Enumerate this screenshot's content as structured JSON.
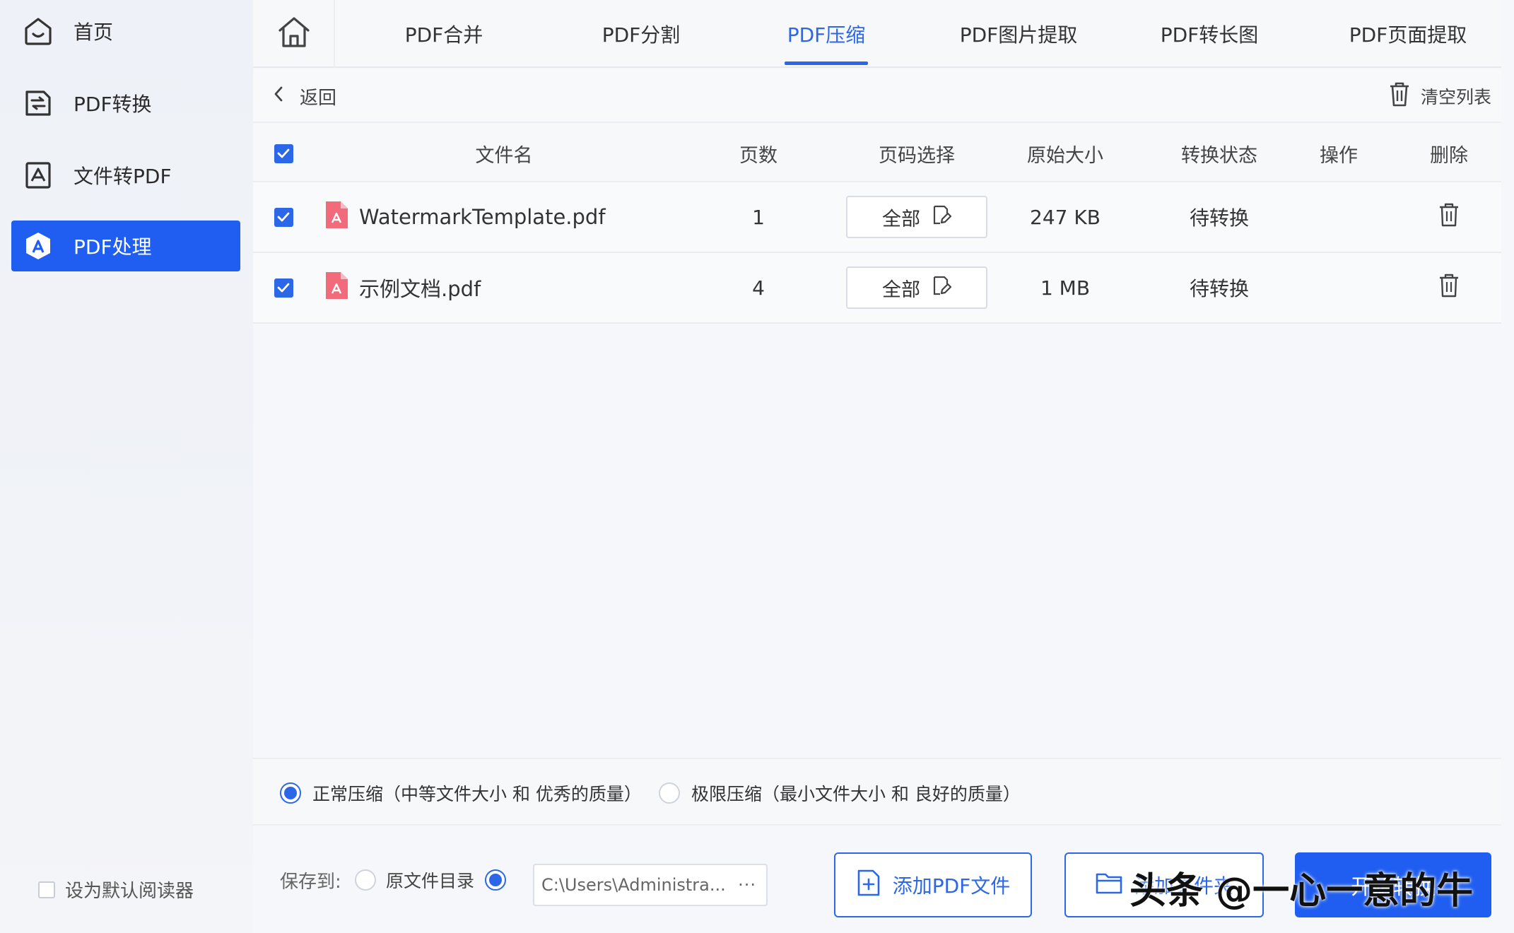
{
  "sidebar": {
    "items": [
      {
        "label": "首页",
        "icon": "home-icon"
      },
      {
        "label": "PDF转换",
        "icon": "convert-icon"
      },
      {
        "label": "文件转PDF",
        "icon": "file-to-pdf-icon"
      },
      {
        "label": "PDF处理",
        "icon": "pdf-process-icon",
        "active": true
      }
    ],
    "default_reader_label": "设为默认阅读器"
  },
  "tabs": [
    {
      "label": "PDF合并"
    },
    {
      "label": "PDF分割"
    },
    {
      "label": "PDF压缩",
      "active": true
    },
    {
      "label": "PDF图片提取"
    },
    {
      "label": "PDF转长图"
    },
    {
      "label": "PDF页面提取"
    }
  ],
  "backbar": {
    "back_label": "返回",
    "clear_label": "清空列表"
  },
  "table": {
    "headers": {
      "filename": "文件名",
      "pages": "页数",
      "page_select": "页码选择",
      "size": "原始大小",
      "status": "转换状态",
      "action": "操作",
      "delete": "删除"
    },
    "rows": [
      {
        "checked": true,
        "filename": "WatermarkTemplate.pdf",
        "pages": "1",
        "page_select": "全部",
        "size": "247 KB",
        "status": "待转换"
      },
      {
        "checked": true,
        "filename": "示例文档.pdf",
        "pages": "4",
        "page_select": "全部",
        "size": "1 MB",
        "status": "待转换"
      }
    ]
  },
  "compression": {
    "normal": {
      "label": "正常压缩（中等文件大小 和 优秀的质量）",
      "selected": true
    },
    "extreme": {
      "label": "极限压缩（最小文件大小 和 良好的质量）",
      "selected": false
    }
  },
  "bottom": {
    "save_to_label": "保存到:",
    "original_dir_label": "原文件目录",
    "path_value": "C:\\Users\\Administra...",
    "path_more": "···",
    "add_pdf_label": "添加PDF文件",
    "add_folder_label": "添加文件夹",
    "start_label": "开始转换"
  },
  "watermark": "头条 @一心一意的牛",
  "colors": {
    "accent": "#2c67e8",
    "primary_button": "#1f5ef0"
  }
}
